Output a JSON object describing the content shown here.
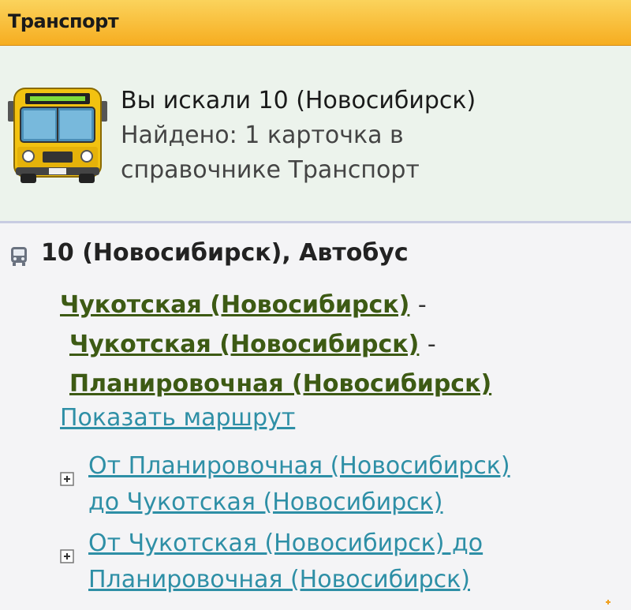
{
  "panel": {
    "title": "Транспорт"
  },
  "summary": {
    "query_line": "Вы искали 10 (Новосибирск)",
    "found_line_1": "Найдено: 1 карточка в",
    "found_line_2": "справочнике Транспорт",
    "icon": "bus-icon"
  },
  "result": {
    "title": "10 (Новосибирск), Автобус",
    "icon": "bus-small-icon",
    "stops": [
      {
        "name": "Чукотская (Новосибирск)",
        "separator": "-"
      },
      {
        "name": "Чукотская (Новосибирск)",
        "separator": "-"
      },
      {
        "name": "Планировочная (Новосибирск)",
        "separator": ""
      }
    ],
    "show_route_label": "Показать маршрут",
    "directions": [
      {
        "line_1": "От Планировочная (Новосибирск)",
        "line_2": "до Чукотская (Новосибирск)",
        "icon": "expand-plus-icon"
      },
      {
        "line_1": "От Чукотская (Новосибирск) до",
        "line_2": "Планировочная (Новосибирск)",
        "icon": "expand-plus-icon"
      }
    ]
  },
  "colors": {
    "header_top": "#fbd35c",
    "header_bottom": "#f6ad20",
    "summary_bg": "#ecf3ec",
    "stop_link": "#3d5a14",
    "route_link": "#2e8fa6"
  }
}
